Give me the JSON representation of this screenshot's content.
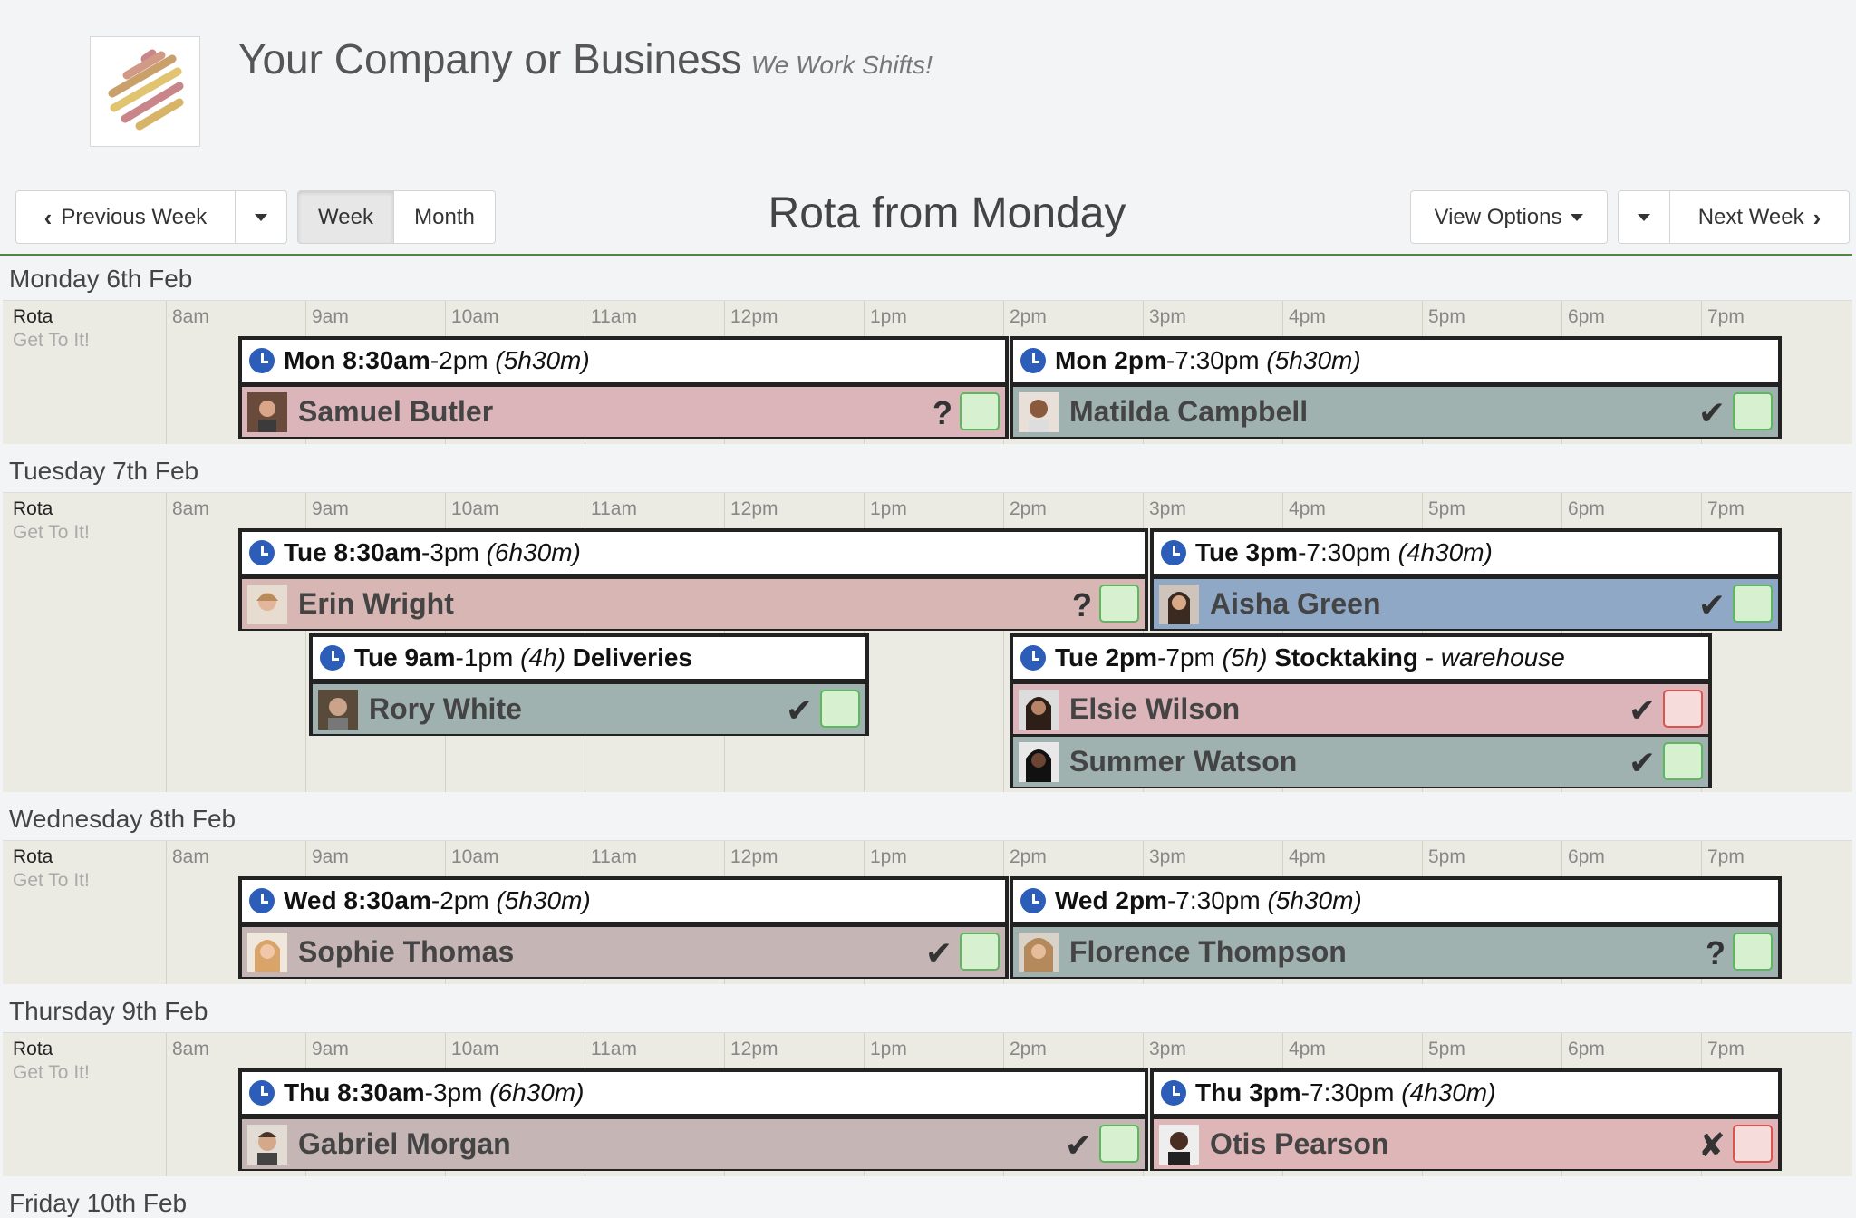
{
  "header": {
    "company_name": "Your Company or Business",
    "tagline": "We Work Shifts!",
    "logo_icon": "striped-logo-icon"
  },
  "toolbar": {
    "previous_week": "Previous Week",
    "week": "Week",
    "month": "Month",
    "title": "Rota from Monday",
    "view_options": "View Options",
    "next_week": "Next Week"
  },
  "rota_label": "Rota",
  "rota_sub": "Get To It!",
  "hours": [
    "8am",
    "9am",
    "10am",
    "11am",
    "12pm",
    "1pm",
    "2pm",
    "3pm",
    "4pm",
    "5pm",
    "6pm",
    "7pm"
  ],
  "days": [
    {
      "label": "Monday 6th Feb"
    },
    {
      "label": "Tuesday 7th Feb"
    },
    {
      "label": "Wednesday 8th Feb"
    },
    {
      "label": "Thursday 9th Feb"
    },
    {
      "label": "Friday 10th Feb"
    }
  ],
  "shifts": {
    "mon_am": {
      "start": "Mon 8:30am",
      "end": "2pm",
      "duration": "(5h30m)",
      "person": "Samuel Butler",
      "status": "?"
    },
    "mon_pm": {
      "start": "Mon 2pm",
      "end": "7:30pm",
      "duration": "(5h30m)",
      "person": "Matilda Campbell",
      "status": "✔"
    },
    "tue_am": {
      "start": "Tue 8:30am",
      "end": "3pm",
      "duration": "(6h30m)",
      "person": "Erin Wright",
      "status": "?"
    },
    "tue_pm": {
      "start": "Tue 3pm",
      "end": "7:30pm",
      "duration": "(4h30m)",
      "person": "Aisha Green",
      "status": "✔"
    },
    "tue_del": {
      "start": "Tue 9am",
      "end": "1pm",
      "duration": "(4h)",
      "title": "Deliveries",
      "person": "Rory White",
      "status": "✔"
    },
    "tue_stock": {
      "start": "Tue 2pm",
      "end": "7pm",
      "duration": "(5h)",
      "title": "Stocktaking",
      "sep": " - ",
      "location": "warehouse",
      "person1": "Elsie Wilson",
      "status1": "✔",
      "person2": "Summer Watson",
      "status2": "✔"
    },
    "wed_am": {
      "start": "Wed 8:30am",
      "end": "2pm",
      "duration": "(5h30m)",
      "person": "Sophie Thomas",
      "status": "✔"
    },
    "wed_pm": {
      "start": "Wed 2pm",
      "end": "7:30pm",
      "duration": "(5h30m)",
      "person": "Florence Thompson",
      "status": "?"
    },
    "thu_am": {
      "start": "Thu 8:30am",
      "end": "3pm",
      "duration": "(6h30m)",
      "person": "Gabriel Morgan",
      "status": "✔"
    },
    "thu_pm": {
      "start": "Thu 3pm",
      "end": "7:30pm",
      "duration": "(4h30m)",
      "person": "Otis Pearson",
      "status": "✘"
    }
  },
  "colors": {
    "accent_line": "#4f8a3c",
    "clock": "#2c5db9",
    "pending": "#dbb5ba",
    "confirmed": "#9fb2b0",
    "blue": "#8ea8c6"
  }
}
